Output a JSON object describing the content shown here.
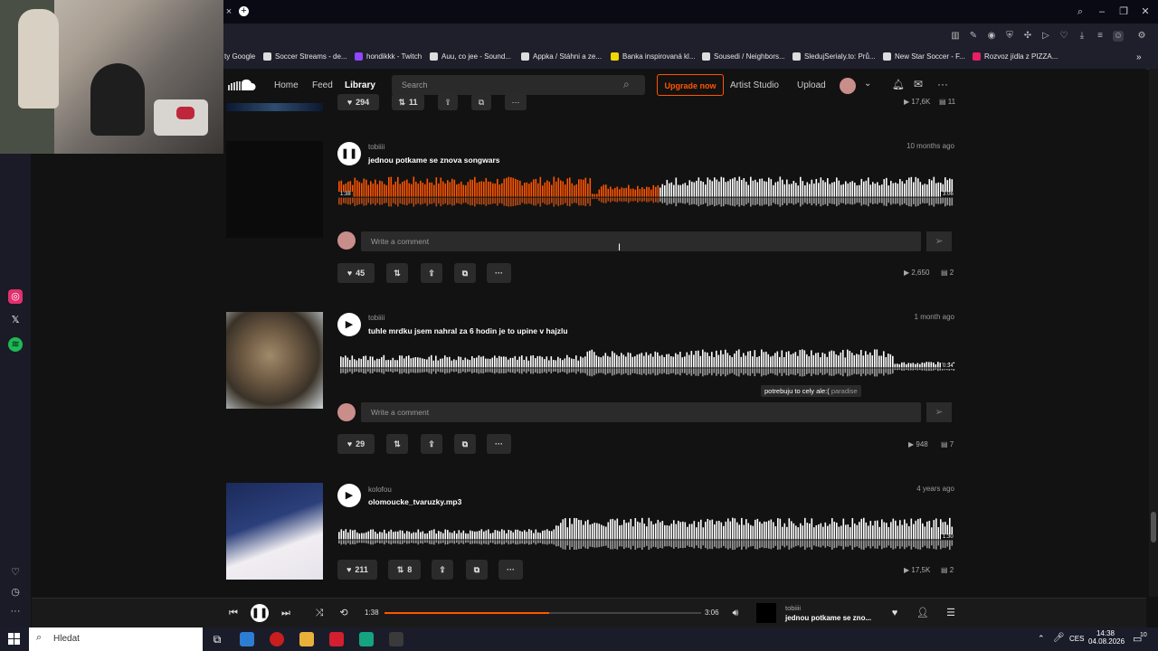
{
  "browser": {
    "bookmarks": [
      {
        "label": "ty Google",
        "color": "#4285f4"
      },
      {
        "label": "Soccer Streams - de...",
        "color": "#dddddd"
      },
      {
        "label": "hondikkk - Twitch",
        "color": "#9146ff"
      },
      {
        "label": "Auu, co jee - Sound...",
        "color": "#dddddd"
      },
      {
        "label": "Appka / Stáhni a ze...",
        "color": "#dddddd"
      },
      {
        "label": "Banka inspirovaná kl...",
        "color": "#f2d500"
      },
      {
        "label": "Sousedi / Neighbors...",
        "color": "#dddddd"
      },
      {
        "label": "SledujSerialy.to: Prů...",
        "color": "#dddddd"
      },
      {
        "label": "New Star Soccer - F...",
        "color": "#dddddd"
      },
      {
        "label": "Rozvoz jídla z PIZZA...",
        "color": "#e91e63"
      }
    ]
  },
  "soundcloud": {
    "nav": {
      "home": "Home",
      "feed": "Feed",
      "library": "Library",
      "search_placeholder": "Search",
      "upgrade": "Upgrade now",
      "artist_studio": "Artist Studio",
      "upload": "Upload"
    },
    "prev_track": {
      "likes": "294",
      "reposts": "11",
      "plays": "17,6K",
      "comments": "11"
    },
    "tracks": [
      {
        "user": "tobiiii",
        "title": "jednou potkame se znova songwars",
        "ago": "10 months ago",
        "state": "playing",
        "progress": 0.52,
        "elapsed": "1:38",
        "duration": "3:06",
        "comment_placeholder": "Write a comment",
        "likes": "45",
        "reposts": "",
        "plays": "2,650",
        "comments": "2"
      },
      {
        "user": "tobiiii",
        "title": "tuhle mrdku jsem nahral za 6 hodin je to upine v hajzlu",
        "ago": "1 month ago",
        "state": "paused",
        "progress": 0,
        "elapsed": "",
        "duration": "0:34",
        "comment_placeholder": "Write a comment",
        "likes": "29",
        "reposts": "",
        "plays": "948",
        "comments": "7",
        "tooltip_comment": "potrebuju to cely ale:(",
        "tooltip_user": "paradise"
      },
      {
        "user": "kolofou",
        "title": "olomoucke_tvaruzky.mp3",
        "ago": "4 years ago",
        "state": "paused",
        "progress": 0,
        "elapsed": "",
        "duration": "1:30",
        "comment_placeholder": "",
        "likes": "211",
        "reposts": "8",
        "plays": "17,5K",
        "comments": "2"
      }
    ],
    "player": {
      "elapsed": "1:38",
      "duration": "3:06",
      "progress": 0.52,
      "user": "tobiiii",
      "title": "jednou potkame se zno..."
    }
  },
  "taskbar": {
    "search_placeholder": "Hledat",
    "lang": "CES",
    "time": "14:38",
    "date": "04.08.2026",
    "notif": "10"
  },
  "colors": {
    "accent": "#ff5500",
    "bg": "#121212"
  }
}
